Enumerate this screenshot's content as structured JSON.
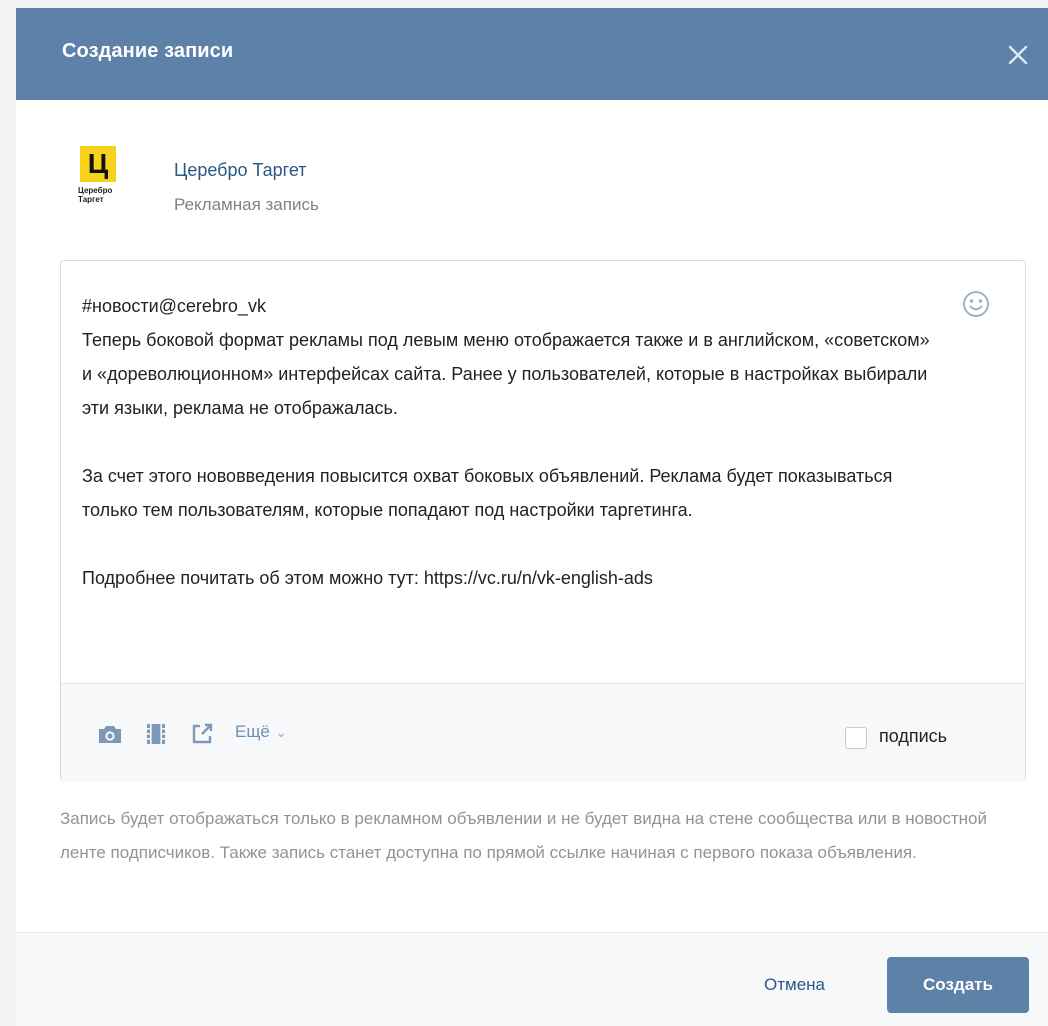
{
  "modal": {
    "title": "Создание записи",
    "close_icon": "close-icon"
  },
  "author": {
    "logo_letter": "Ц",
    "logo_caption": "Церебро Таргет",
    "name": "Церебро Таргет",
    "subtitle": "Рекламная запись"
  },
  "editor": {
    "text": "#новости@cerebro_vk\nТеперь боковой формат рекламы под левым меню отображается также и в английском, «советском» и «дореволюционном» интерфейсах сайта. Ранее у пользователей, которые в настройках выбирали эти языки, реклама не отображалась.\n\nЗа счет этого нововведения повысится охват боковых объявлений. Реклама будет показываться только тем пользователям, которые попадают под настройки таргетинга.\n\nПодробнее почитать об этом можно тут: https://vc.ru/n/vk-english-ads",
    "emoji_icon": "smile-icon",
    "tools": [
      "camera-icon",
      "video-icon",
      "link-icon"
    ],
    "more_label": "Ещё",
    "signature_label": "подпись",
    "signature_checked": false
  },
  "hint": "Запись будет отображаться только в рекламном объявлении и не будет видна на стене сообщества или в новостной ленте подписчиков. Также запись станет доступна по прямой ссылке начиная с первого показа объявления.",
  "footer": {
    "cancel_label": "Отмена",
    "create_label": "Создать"
  },
  "colors": {
    "header": "#5d81a8",
    "link": "#2a5885",
    "primary_button": "#5e81a8",
    "logo_yellow": "#f6d31a"
  }
}
